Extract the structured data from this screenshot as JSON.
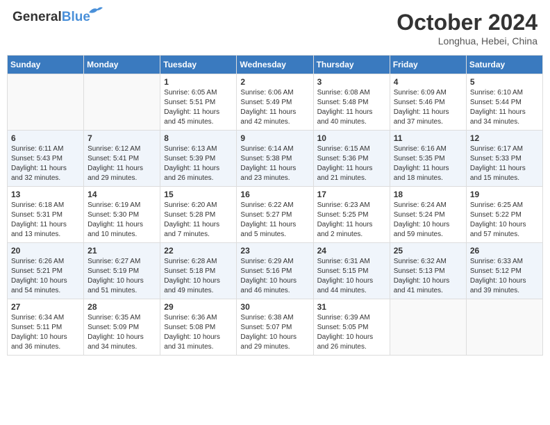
{
  "header": {
    "logo_general": "General",
    "logo_blue": "Blue",
    "month": "October 2024",
    "location": "Longhua, Hebei, China"
  },
  "days_of_week": [
    "Sunday",
    "Monday",
    "Tuesday",
    "Wednesday",
    "Thursday",
    "Friday",
    "Saturday"
  ],
  "weeks": [
    [
      {
        "day": "",
        "info": ""
      },
      {
        "day": "",
        "info": ""
      },
      {
        "day": "1",
        "info": "Sunrise: 6:05 AM\nSunset: 5:51 PM\nDaylight: 11 hours and 45 minutes."
      },
      {
        "day": "2",
        "info": "Sunrise: 6:06 AM\nSunset: 5:49 PM\nDaylight: 11 hours and 42 minutes."
      },
      {
        "day": "3",
        "info": "Sunrise: 6:08 AM\nSunset: 5:48 PM\nDaylight: 11 hours and 40 minutes."
      },
      {
        "day": "4",
        "info": "Sunrise: 6:09 AM\nSunset: 5:46 PM\nDaylight: 11 hours and 37 minutes."
      },
      {
        "day": "5",
        "info": "Sunrise: 6:10 AM\nSunset: 5:44 PM\nDaylight: 11 hours and 34 minutes."
      }
    ],
    [
      {
        "day": "6",
        "info": "Sunrise: 6:11 AM\nSunset: 5:43 PM\nDaylight: 11 hours and 32 minutes."
      },
      {
        "day": "7",
        "info": "Sunrise: 6:12 AM\nSunset: 5:41 PM\nDaylight: 11 hours and 29 minutes."
      },
      {
        "day": "8",
        "info": "Sunrise: 6:13 AM\nSunset: 5:39 PM\nDaylight: 11 hours and 26 minutes."
      },
      {
        "day": "9",
        "info": "Sunrise: 6:14 AM\nSunset: 5:38 PM\nDaylight: 11 hours and 23 minutes."
      },
      {
        "day": "10",
        "info": "Sunrise: 6:15 AM\nSunset: 5:36 PM\nDaylight: 11 hours and 21 minutes."
      },
      {
        "day": "11",
        "info": "Sunrise: 6:16 AM\nSunset: 5:35 PM\nDaylight: 11 hours and 18 minutes."
      },
      {
        "day": "12",
        "info": "Sunrise: 6:17 AM\nSunset: 5:33 PM\nDaylight: 11 hours and 15 minutes."
      }
    ],
    [
      {
        "day": "13",
        "info": "Sunrise: 6:18 AM\nSunset: 5:31 PM\nDaylight: 11 hours and 13 minutes."
      },
      {
        "day": "14",
        "info": "Sunrise: 6:19 AM\nSunset: 5:30 PM\nDaylight: 11 hours and 10 minutes."
      },
      {
        "day": "15",
        "info": "Sunrise: 6:20 AM\nSunset: 5:28 PM\nDaylight: 11 hours and 7 minutes."
      },
      {
        "day": "16",
        "info": "Sunrise: 6:22 AM\nSunset: 5:27 PM\nDaylight: 11 hours and 5 minutes."
      },
      {
        "day": "17",
        "info": "Sunrise: 6:23 AM\nSunset: 5:25 PM\nDaylight: 11 hours and 2 minutes."
      },
      {
        "day": "18",
        "info": "Sunrise: 6:24 AM\nSunset: 5:24 PM\nDaylight: 10 hours and 59 minutes."
      },
      {
        "day": "19",
        "info": "Sunrise: 6:25 AM\nSunset: 5:22 PM\nDaylight: 10 hours and 57 minutes."
      }
    ],
    [
      {
        "day": "20",
        "info": "Sunrise: 6:26 AM\nSunset: 5:21 PM\nDaylight: 10 hours and 54 minutes."
      },
      {
        "day": "21",
        "info": "Sunrise: 6:27 AM\nSunset: 5:19 PM\nDaylight: 10 hours and 51 minutes."
      },
      {
        "day": "22",
        "info": "Sunrise: 6:28 AM\nSunset: 5:18 PM\nDaylight: 10 hours and 49 minutes."
      },
      {
        "day": "23",
        "info": "Sunrise: 6:29 AM\nSunset: 5:16 PM\nDaylight: 10 hours and 46 minutes."
      },
      {
        "day": "24",
        "info": "Sunrise: 6:31 AM\nSunset: 5:15 PM\nDaylight: 10 hours and 44 minutes."
      },
      {
        "day": "25",
        "info": "Sunrise: 6:32 AM\nSunset: 5:13 PM\nDaylight: 10 hours and 41 minutes."
      },
      {
        "day": "26",
        "info": "Sunrise: 6:33 AM\nSunset: 5:12 PM\nDaylight: 10 hours and 39 minutes."
      }
    ],
    [
      {
        "day": "27",
        "info": "Sunrise: 6:34 AM\nSunset: 5:11 PM\nDaylight: 10 hours and 36 minutes."
      },
      {
        "day": "28",
        "info": "Sunrise: 6:35 AM\nSunset: 5:09 PM\nDaylight: 10 hours and 34 minutes."
      },
      {
        "day": "29",
        "info": "Sunrise: 6:36 AM\nSunset: 5:08 PM\nDaylight: 10 hours and 31 minutes."
      },
      {
        "day": "30",
        "info": "Sunrise: 6:38 AM\nSunset: 5:07 PM\nDaylight: 10 hours and 29 minutes."
      },
      {
        "day": "31",
        "info": "Sunrise: 6:39 AM\nSunset: 5:05 PM\nDaylight: 10 hours and 26 minutes."
      },
      {
        "day": "",
        "info": ""
      },
      {
        "day": "",
        "info": ""
      }
    ]
  ]
}
